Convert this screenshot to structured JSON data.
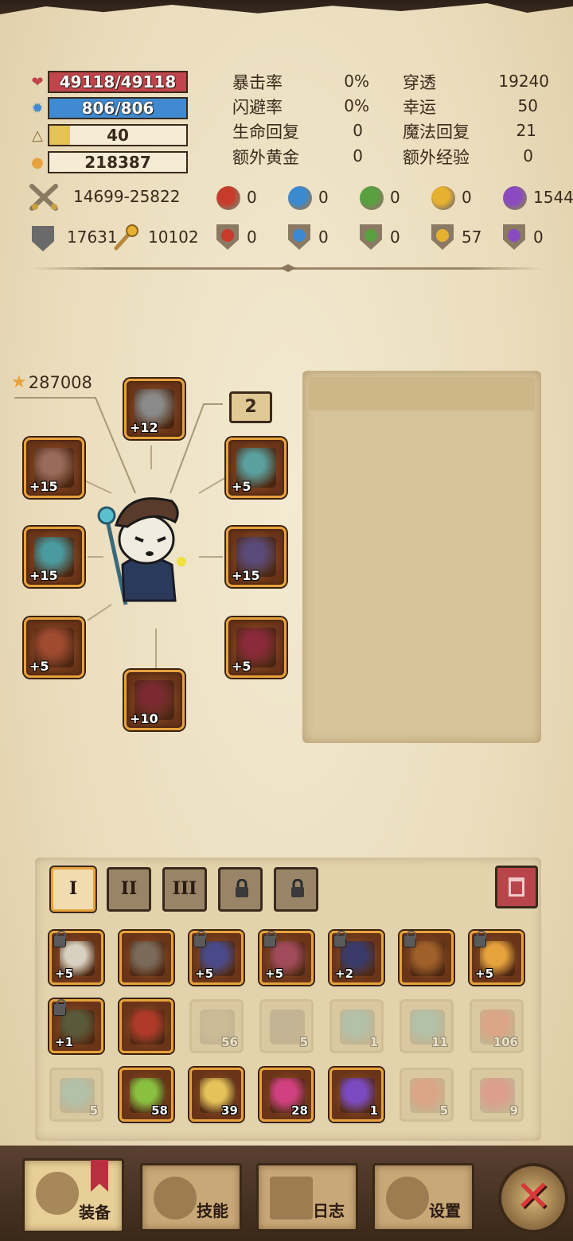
{
  "bars": {
    "hp": {
      "text": "49118/49118",
      "icon": "heart-icon",
      "color": "#c0454c",
      "fill": 1.0
    },
    "mp": {
      "text": "806/806",
      "icon": "mana-gear-icon",
      "color": "#3f8ad0",
      "fill": 1.0
    },
    "level": {
      "text": "40",
      "icon": "level-triangle-icon",
      "color": "#e6c25a",
      "fill": 0.15
    },
    "gold": {
      "text": "218387",
      "icon": "gold-icon",
      "color": "#e6c25a",
      "fill": 0
    }
  },
  "stats": [
    {
      "label": "暴击率",
      "value": "0%"
    },
    {
      "label": "闪避率",
      "value": "0%"
    },
    {
      "label": "生命回复",
      "value": "0"
    },
    {
      "label": "额外黄金",
      "value": "0"
    },
    {
      "label": "穿透",
      "value": "19240"
    },
    {
      "label": "幸运",
      "value": "50"
    },
    {
      "label": "魔法回复",
      "value": "21"
    },
    {
      "label": "额外经验",
      "value": "0"
    }
  ],
  "attack": {
    "range": "14699-25822",
    "icon": "crossed-swords-icon"
  },
  "defense": {
    "armor": "17631",
    "magic": "10102"
  },
  "element_attack": [
    {
      "name": "fire",
      "value": "0",
      "color": "#c83a2a"
    },
    {
      "name": "water",
      "value": "0",
      "color": "#3a8ad0"
    },
    {
      "name": "nature",
      "value": "0",
      "color": "#5aa040"
    },
    {
      "name": "lightning",
      "value": "0",
      "color": "#e6b030"
    },
    {
      "name": "arcane",
      "value": "1544",
      "color": "#8a4ac0"
    }
  ],
  "element_defense": [
    {
      "name": "fire",
      "value": "0",
      "color": "#c83a2a"
    },
    {
      "name": "water",
      "value": "0",
      "color": "#3a8ad0"
    },
    {
      "name": "nature",
      "value": "0",
      "color": "#5aa040"
    },
    {
      "name": "lightning",
      "value": "57",
      "color": "#e6b030"
    },
    {
      "name": "arcane",
      "value": "0",
      "color": "#8a4ac0"
    }
  ],
  "equipment": {
    "score": "287008",
    "slot_count": "2",
    "slots": [
      {
        "name": "helmet",
        "plus": "+12",
        "color": "#8a8a8a"
      },
      {
        "name": "ring",
        "plus": "+15",
        "color": "#9a6a5a"
      },
      {
        "name": "amulet",
        "plus": "+5",
        "color": "#5aa0a0"
      },
      {
        "name": "weapon",
        "plus": "+15",
        "color": "#4a9aa0"
      },
      {
        "name": "armor",
        "plus": "+15",
        "color": "#5a4a7a"
      },
      {
        "name": "gloves",
        "plus": "+5",
        "color": "#a04a30"
      },
      {
        "name": "pants",
        "plus": "+5",
        "color": "#8a2a3a"
      },
      {
        "name": "boots",
        "plus": "+10",
        "color": "#7a2a30"
      }
    ]
  },
  "inventory": {
    "tabs": [
      "I",
      "II",
      "III",
      "",
      ""
    ],
    "rows": [
      [
        {
          "name": "scimitar",
          "label": "+5",
          "color": "#d8d0c0",
          "locked": true,
          "faded": false
        },
        {
          "name": "mystery-helm",
          "label": "",
          "color": "#7a6a5a",
          "locked": false,
          "faded": false
        },
        {
          "name": "demon-helmet",
          "label": "+5",
          "color": "#4a4a8a",
          "locked": true,
          "faded": false
        },
        {
          "name": "chest-armor",
          "label": "+5",
          "color": "#a04a5a",
          "locked": true,
          "faded": false
        },
        {
          "name": "dark-armor",
          "label": "+2",
          "color": "#3a3a6a",
          "locked": true,
          "faded": false
        },
        {
          "name": "leather-gloves",
          "label": "",
          "color": "#a0602a",
          "locked": true,
          "faded": false
        },
        {
          "name": "gold-amulet",
          "label": "+5",
          "color": "#e6a23c",
          "locked": true,
          "faded": false
        }
      ],
      [
        {
          "name": "rune-ring",
          "label": "+1",
          "color": "#5a5a3a",
          "locked": true,
          "faded": false
        },
        {
          "name": "demon-gloves",
          "label": "",
          "color": "#b03a2a",
          "locked": false,
          "faded": false
        },
        {
          "name": "scroll",
          "label": "56",
          "color": "#a09070",
          "locked": false,
          "faded": true
        },
        {
          "name": "pickaxe",
          "label": "5",
          "color": "#8a7a6a",
          "locked": false,
          "faded": true
        },
        {
          "name": "green-potion",
          "label": "1",
          "color": "#5aa0a0",
          "locked": false,
          "faded": true
        },
        {
          "name": "eye-scroll",
          "label": "11",
          "color": "#5aa0a0",
          "locked": false,
          "faded": true
        },
        {
          "name": "red-potion",
          "label": "106",
          "color": "#d05040",
          "locked": false,
          "faded": true
        }
      ],
      [
        {
          "name": "green-flask",
          "label": "5",
          "color": "#5aa0a0",
          "locked": false,
          "faded": true
        },
        {
          "name": "green-potion-gold",
          "label": "58",
          "color": "#8ac040",
          "locked": false,
          "faded": false
        },
        {
          "name": "gold-potion",
          "label": "39",
          "color": "#e6c25a",
          "locked": false,
          "faded": false
        },
        {
          "name": "pink-star-potion",
          "label": "28",
          "color": "#d04080",
          "locked": false,
          "faded": false
        },
        {
          "name": "purple-swirl-potion",
          "label": "1",
          "color": "#7a4ac0",
          "locked": false,
          "faded": false
        },
        {
          "name": "red-big-potion",
          "label": "5",
          "color": "#d05040",
          "locked": false,
          "faded": true
        },
        {
          "name": "red-flask",
          "label": "9",
          "color": "#d04050",
          "locked": false,
          "faded": true
        }
      ]
    ]
  },
  "nav": [
    {
      "name": "equipment",
      "label": "装备"
    },
    {
      "name": "skills",
      "label": "技能"
    },
    {
      "name": "log",
      "label": "日志"
    },
    {
      "name": "settings",
      "label": "设置"
    }
  ],
  "close": "✕"
}
